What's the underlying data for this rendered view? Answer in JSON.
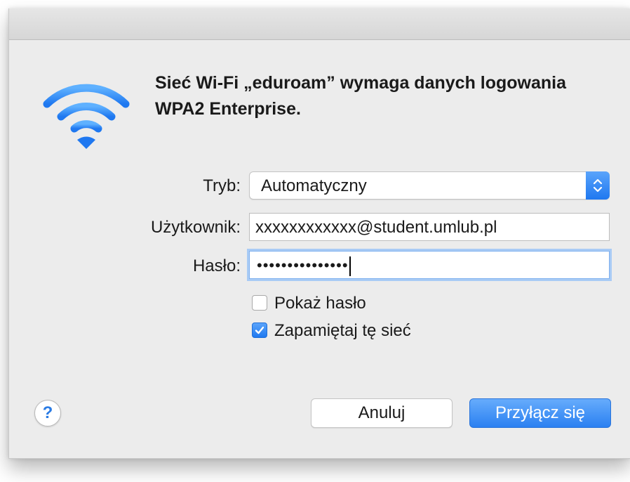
{
  "dialog": {
    "heading_line1": "Sieć Wi-Fi „eduroam” wymaga danych logowania",
    "heading_line2": "WPA2 Enterprise.",
    "icon": "wifi-icon",
    "accent_color": "#2f86f5"
  },
  "form": {
    "mode_label": "Tryb:",
    "mode_value": "Automatyczny",
    "user_label": "Użytkownik:",
    "user_value": "xxxxxxxxxxxx@student.umlub.pl",
    "password_label": "Hasło:",
    "password_masked": "•••••••••••••••"
  },
  "options": {
    "show_password_label": "Pokaż hasło",
    "show_password_checked": false,
    "remember_label": "Zapamiętaj tę sieć",
    "remember_checked": true
  },
  "buttons": {
    "help_label": "?",
    "cancel_label": "Anuluj",
    "join_label": "Przyłącz się"
  }
}
